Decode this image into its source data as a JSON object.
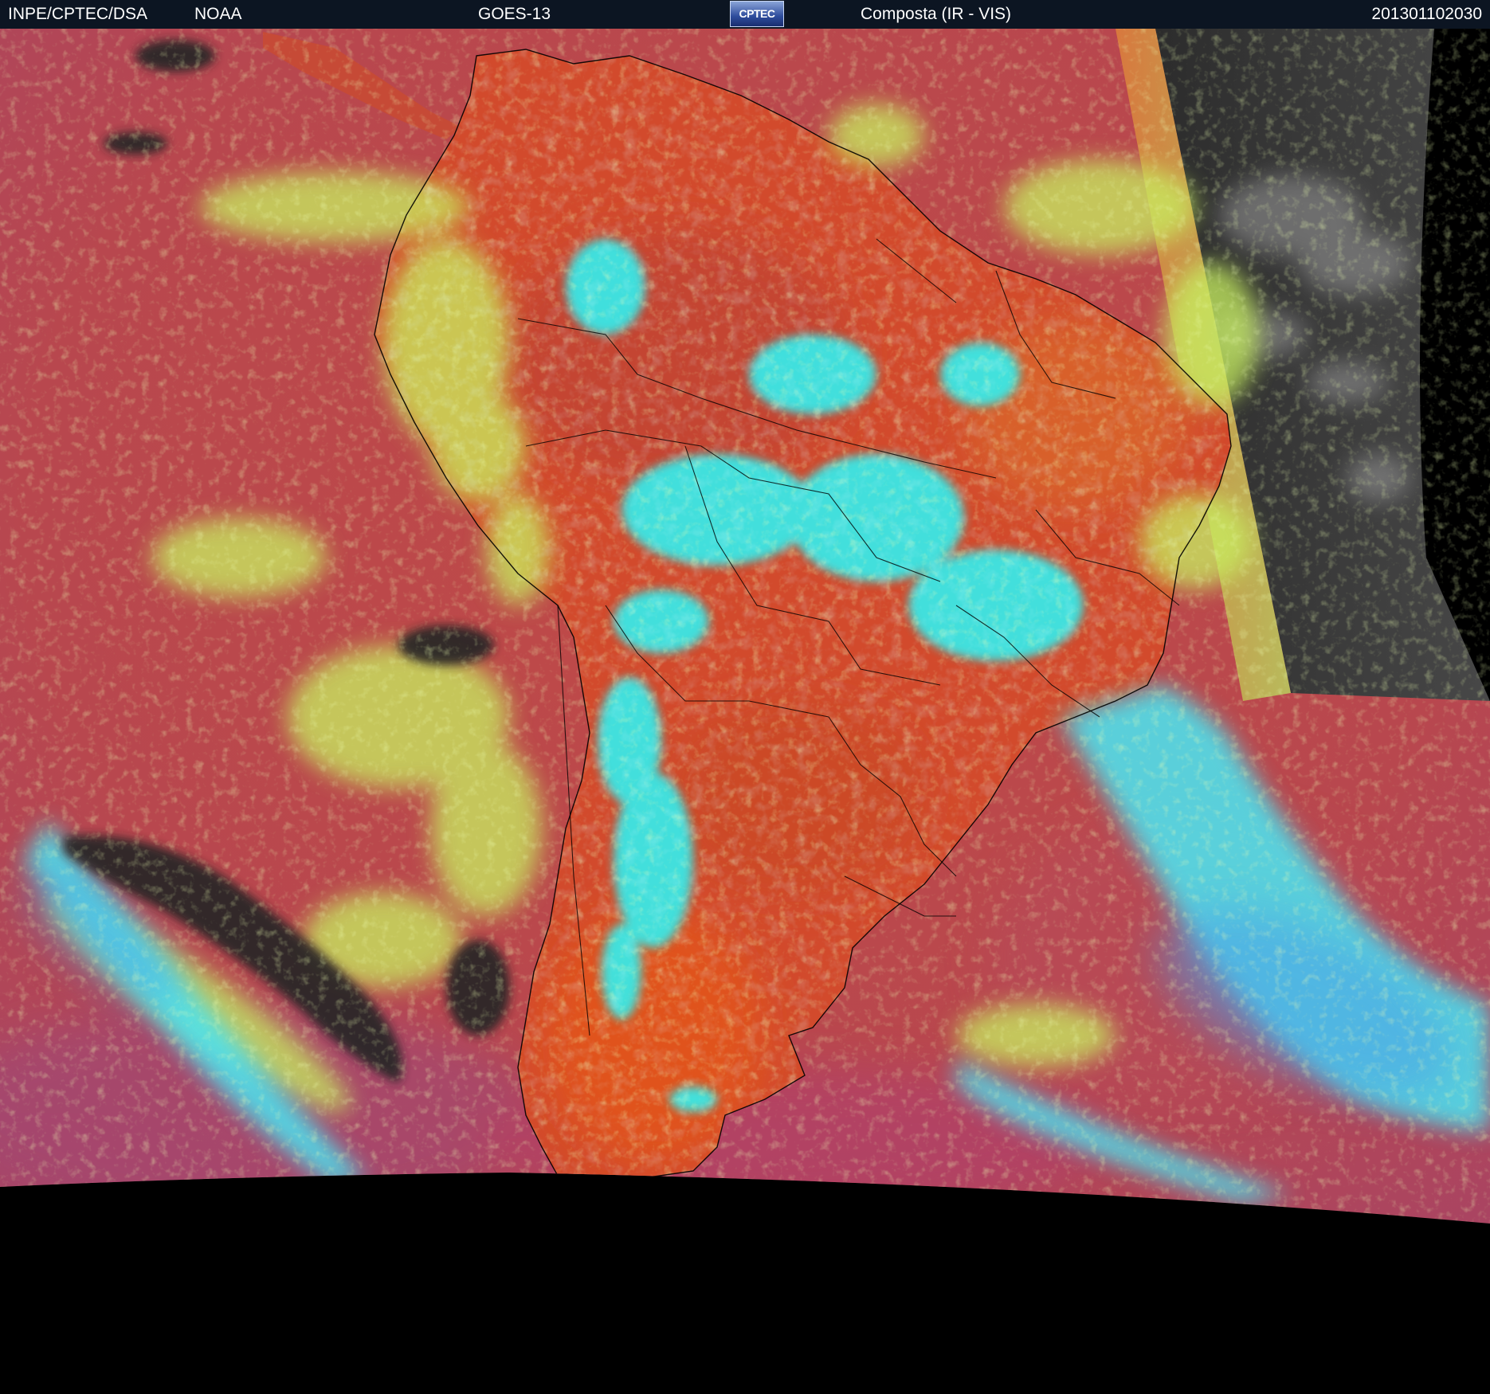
{
  "header": {
    "agency": "INPE/CPTEC/DSA",
    "partner": "NOAA",
    "satellite": "GOES-13",
    "logo_text": "CPTEC",
    "product": "Composta (IR - VIS)",
    "timestamp": "201301102030"
  },
  "colors": {
    "header_bg": "#0c1522",
    "ocean_red": "#b8474e",
    "land_orange": "#d24a2c",
    "low_cloud_yellow_green": "#c8f060",
    "high_cloud_cyan": "#30f0f0",
    "night_gray": "#3a3a3a",
    "space": "#000000"
  }
}
